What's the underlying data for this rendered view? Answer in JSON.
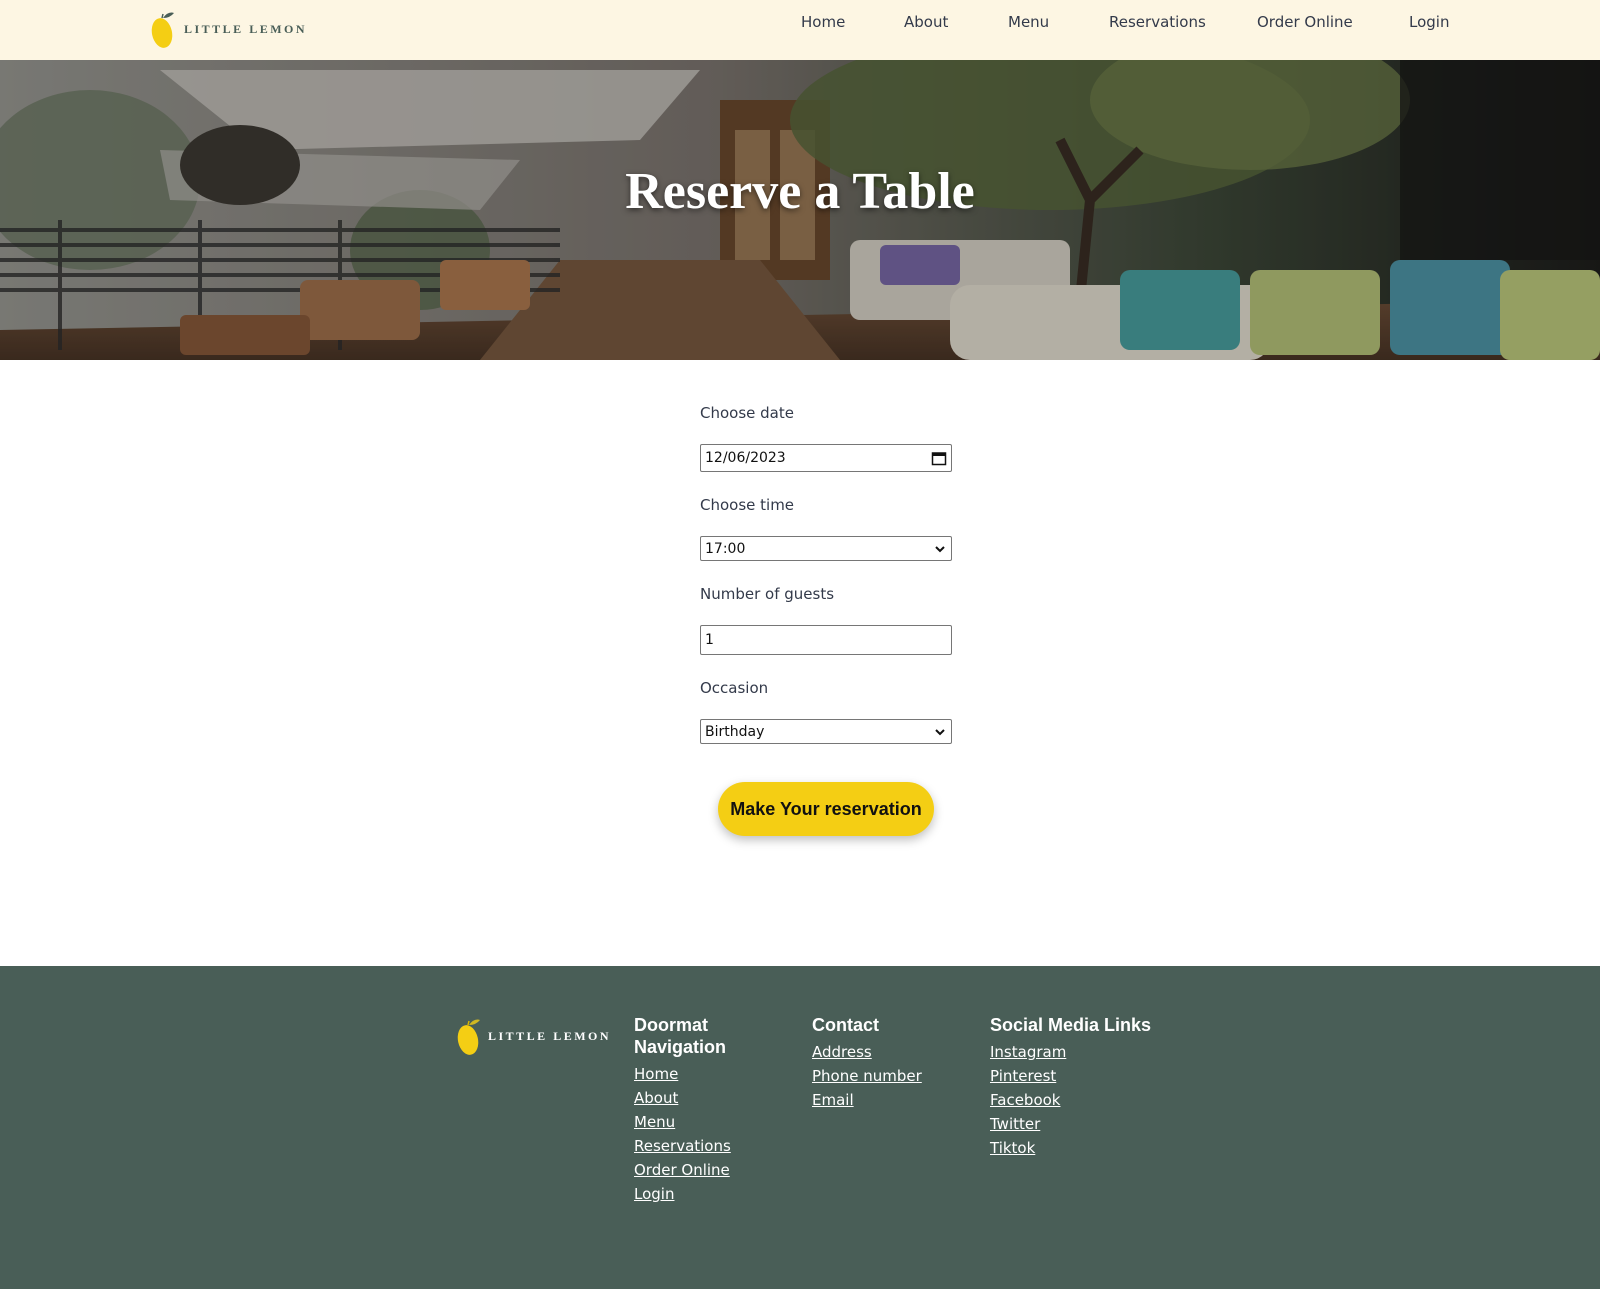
{
  "brand": {
    "name": "LITTLE LEMON"
  },
  "colors": {
    "header_bg": "#fdf6e3",
    "accent": "#f4ce14",
    "footer_bg": "#495e57",
    "brand_green": "#495e57"
  },
  "nav": [
    {
      "label": "Home"
    },
    {
      "label": "About"
    },
    {
      "label": "Menu"
    },
    {
      "label": "Reservations"
    },
    {
      "label": "Order Online"
    },
    {
      "label": "Login"
    }
  ],
  "hero": {
    "title": "Reserve a Table"
  },
  "form": {
    "date_label": "Choose date",
    "date_value": "12/06/2023",
    "time_label": "Choose time",
    "time_value": "17:00",
    "guests_label": "Number of guests",
    "guests_value": "1",
    "occasion_label": "Occasion",
    "occasion_value": "Birthday",
    "submit_label": "Make Your reservation"
  },
  "footer": {
    "doormat": {
      "title": "Doormat Navigation",
      "links": [
        "Home",
        "About",
        "Menu",
        "Reservations",
        "Order Online",
        "Login"
      ]
    },
    "contact": {
      "title": "Contact",
      "links": [
        "Address",
        "Phone number",
        "Email"
      ]
    },
    "social": {
      "title": "Social Media Links",
      "links": [
        "Instagram",
        "Pinterest",
        "Facebook",
        "Twitter",
        "Tiktok"
      ]
    }
  }
}
